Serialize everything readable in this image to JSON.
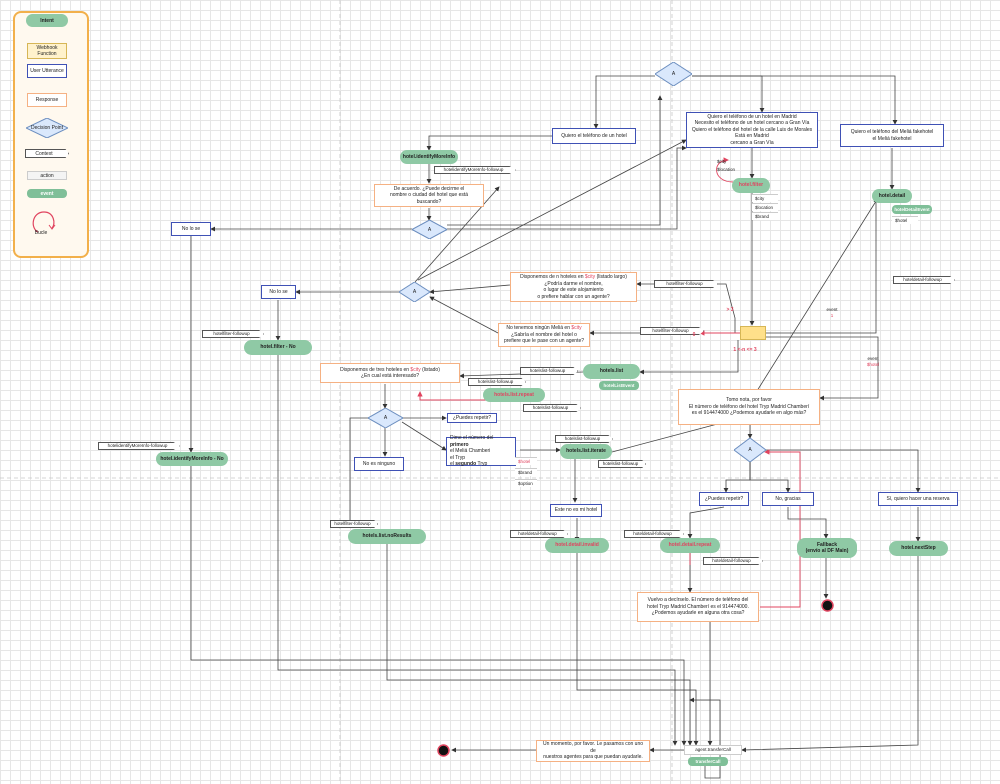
{
  "legend": {
    "intent": "Intent",
    "webhook": "Webhook Function",
    "utterance": "User Utterance",
    "response": "Response",
    "decision": "Decision Point",
    "context": "Context",
    "action": "action",
    "event": "event",
    "loop": "Bucle"
  },
  "diamond_label": "A",
  "utterances": {
    "quiero_hotel": "Quiero el teléfono de un hotel",
    "quiero_madrid": [
      "Quiero el teléfono de un hotel en Madrid",
      "Necesito el teléfono de un hotel cercano a Gran Vía",
      "Quiero el teléfono del hotel de la calle Luis de Morales",
      "Está en Madrid",
      "cercano a Gran Vía"
    ],
    "quiero_melia": [
      "Quiero el teléfono del Meliá fakehotel",
      "el Meliá fakehotel"
    ],
    "no_lo_se_1": "No lo se",
    "no_lo_se_2": "No lo se",
    "dime_numero": [
      "Dime el número del",
      "primero",
      "el Meliá Chamberi",
      "el Tryp",
      "el",
      "segundo",
      "Tryp"
    ],
    "ninguno": "No es ninguno",
    "este_no": "Este no es mi hotel",
    "puedes_repetir_1": "¿Puedes repetir?",
    "puedes_repetir_2": "¿Puedes repetir?",
    "no_gracias": "No, gracias",
    "si_reserva": "Sí, quiero hacer una reserva"
  },
  "responses": {
    "de_acuerdo": [
      "De acuerdo. ¿Puede decirme el",
      "nombre o ciudad del hotel que está buscando?"
    ],
    "disponemos_n": [
      "Disponemos de n hoteles en",
      "$city",
      "(listado largo)",
      "¿Podría darme el nombre,",
      "o lugar de este alojamiento",
      "o prefiere hablar con un agente?"
    ],
    "no_tenemos": [
      "No tenemos ningún Meliá en",
      "$city",
      "¿Sabría el nombre del hotel o",
      "prefiere que le pase con un agente?"
    ],
    "disponemos_tres": [
      "Disponemos de tres hoteles en",
      "$city",
      "(listado)",
      "¿En cual está interesado?"
    ],
    "tomo_nota": [
      "Tomo nota, por favor",
      "El número de teléfono del hotel Tryp Madrid Chamberí",
      "es el 914474000 ¿Podemos ayudarle en algo más?"
    ],
    "vuelvo": [
      "Vuelvo a decírselo. El número de teléfono del",
      "hotel Tryp Madrid Chamberí es el 914474000.",
      "¿Podemos ayudarle en alguna otra cosa?"
    ],
    "un_momento": [
      "Un momento, por favor. Le pasamos con uno de",
      "nuestros agentes para que puedan ayudarle."
    ]
  },
  "intents": {
    "identify": "hotel.identifyMoreInfo",
    "identify_no": "hotel.identifyMoreInfo - No",
    "filter": "hotel.filter",
    "filter_no": "hotel.filter - No",
    "detail": "hotel.detail",
    "detail_event": "hotelDetailEvent",
    "list": "hotels.list",
    "list_event": "hotelListEvent",
    "list_repeat": "hotels.list.repeat",
    "list_iterate": "hotels.list.iterate",
    "no_results": "hotels.list.noResults",
    "detail_invalid": "hotel.detail.invalid",
    "detail_repeat": "hotel.detail.repeat",
    "fallback": [
      "Fallback",
      "(envío al DF Main)"
    ],
    "next_step": "hotel.nextStep",
    "transfer": "transferCall",
    "transfer_action": "agent.transferCall"
  },
  "contexts": {
    "identify_fu": "hotelidentifyMoreInfo-followup",
    "identify_fu_left": "hotelidentifyMoreInfo-followup",
    "filter_fu_1": "hotelfilter-followup",
    "filter_fu_2": "hotelfilter-followup",
    "filter_fu_left": "hotelfilter-followup",
    "filter_fu_bottom": "hotelfilter-followup",
    "detail_fu_right": "hoteldetail-followup",
    "list_fu_1": "hotelslist-followup",
    "list_fu_2": "hotelslist-followup",
    "list_fu_3": "hotelslist-followup",
    "list_fu_4": "hotelslist-followup",
    "list_fu_5": "hotelslist-followup",
    "detail_fu_a": "hoteldetail-followup",
    "detail_fu_b": "hoteldetail-followup",
    "detail_fu_c": "hoteldetail-followup"
  },
  "params": {
    "filter": [
      "$city",
      "$location",
      "$brand"
    ],
    "filter_loop": [
      "$city",
      "$location"
    ],
    "detail": "$hotel",
    "iterate": [
      "$hotel",
      "$brand",
      "$option"
    ]
  },
  "edge_labels": {
    "gt3": "> 3",
    "eq0": "0",
    "range": "1 <-n <= 3",
    "event1": [
      "event",
      "1"
    ],
    "event_hotel": [
      "event",
      "$hotel"
    ]
  },
  "colors": {
    "intent": "#8fc9a5",
    "utterance": "#3f51b5",
    "response": "#f5b183",
    "decision": "#dae8fc",
    "loop": "#e0445f",
    "legend_border": "#f2b04b"
  }
}
